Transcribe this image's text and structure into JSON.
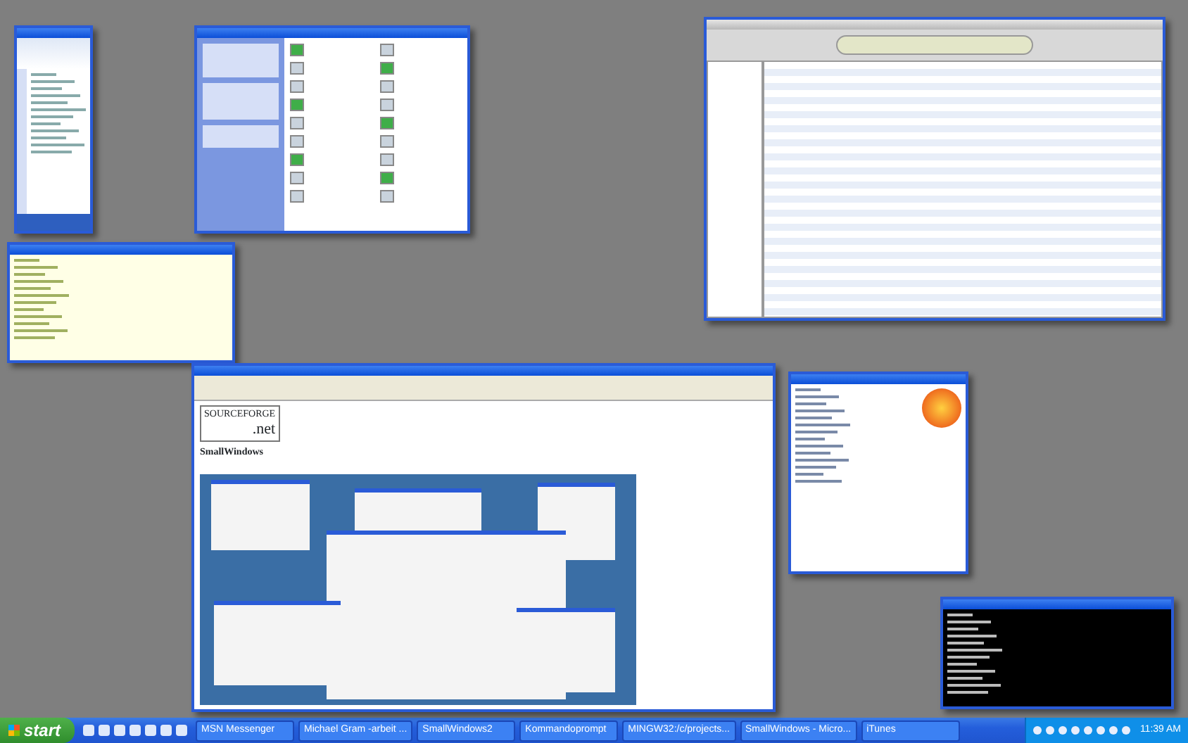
{
  "desktop": {
    "windows": [
      {
        "kind": "messenger"
      },
      {
        "kind": "explorer"
      },
      {
        "kind": "itunes"
      },
      {
        "kind": "console"
      },
      {
        "kind": "browser",
        "page": {
          "logo_top": "SOURCEFORGE",
          "logo_bottom": ".net",
          "heading": "SmallWindows"
        }
      },
      {
        "kind": "chat"
      },
      {
        "kind": "cmd"
      }
    ]
  },
  "taskbar": {
    "start": "start",
    "buttons": [
      {
        "label": "MSN Messenger",
        "selected": false
      },
      {
        "label": "Michael Gram -arbeit ...",
        "selected": false
      },
      {
        "label": "SmallWindows2",
        "selected": false
      },
      {
        "label": "Kommandoprompt",
        "selected": false
      },
      {
        "label": "MINGW32:/c/projects...",
        "selected": false
      },
      {
        "label": "SmallWindows - Micro...",
        "selected": false
      },
      {
        "label": "iTunes",
        "selected": false
      }
    ],
    "clock": "11:39 AM"
  }
}
